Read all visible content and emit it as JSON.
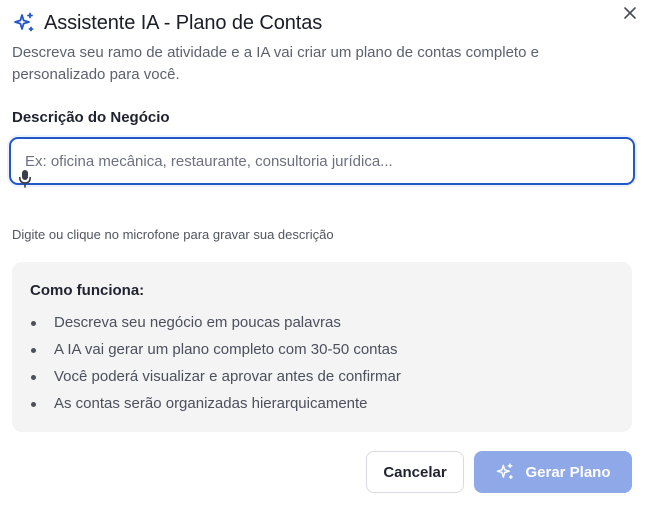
{
  "dialog": {
    "title": "Assistente IA - Plano de Contas",
    "subtitle": "Descreva seu ramo de atividade e a IA vai criar um plano de contas completo e personalizado para você.",
    "icons": {
      "title_icon": "sparkles-icon",
      "close_icon": "close-icon",
      "mic_icon": "microphone-icon"
    }
  },
  "form": {
    "label": "Descrição do Negócio",
    "input_value": "",
    "placeholder": "Ex: oficina mecânica, restaurante, consultoria jurídica...",
    "hint": "Digite ou clique no microfone para gravar sua descrição"
  },
  "info": {
    "title": "Como funciona:",
    "items": [
      "Descreva seu negócio em poucas palavras",
      "A IA vai gerar um plano completo com 30-50 contas",
      "Você poderá visualizar e aprovar antes de confirmar",
      "As contas serão organizadas hierarquicamente"
    ]
  },
  "actions": {
    "cancel_label": "Cancelar",
    "generate_label": "Gerar Plano",
    "generate_icon": "sparkles-icon"
  },
  "colors": {
    "accent": "#2357c9",
    "generate_button_disabled": "#8fa9e8",
    "info_background": "#f4f4f5"
  }
}
